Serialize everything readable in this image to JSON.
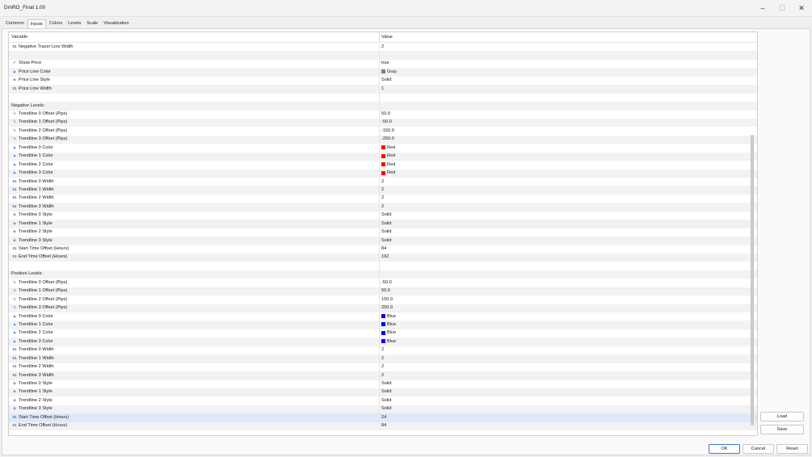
{
  "window": {
    "title": "DmRO_Final 1.00",
    "minimize": "–",
    "maximize": "☐",
    "close": "✕"
  },
  "tabs": [
    "Common",
    "Inputs",
    "Colors",
    "Levels",
    "Scale",
    "Visualization"
  ],
  "active_tab": "Inputs",
  "columns": {
    "variable": "Variable",
    "value": "Value"
  },
  "rows": [
    {
      "icon": "num",
      "name": "Negative Tracer Line Width",
      "value": "2"
    },
    {
      "icon": "",
      "name": "",
      "value": ""
    },
    {
      "icon": "bool",
      "name": "Show Price",
      "value": "true"
    },
    {
      "icon": "color",
      "name": "Price Line Color",
      "value": "Gray",
      "color": "#808080"
    },
    {
      "icon": "style",
      "name": "Price Line Style",
      "value": "Solid"
    },
    {
      "icon": "num",
      "name": "Price Line Width",
      "value": "1"
    },
    {
      "icon": "",
      "name": "",
      "value": ""
    },
    {
      "icon": "",
      "name": "Negative Levels:",
      "value": ""
    },
    {
      "icon": "frac",
      "name": "Trendline 0 Offset (Pips)",
      "value": "50.0"
    },
    {
      "icon": "frac",
      "name": "Trendline 1 Offset (Pips)",
      "value": "-50.0"
    },
    {
      "icon": "frac",
      "name": "Trendline 2 Offset (Pips)",
      "value": "-150.0"
    },
    {
      "icon": "frac",
      "name": "Trendline 3 Offset (Pips)",
      "value": "-250.0"
    },
    {
      "icon": "color",
      "name": "Trendline 0 Color",
      "value": "Red",
      "color": "#ff0000"
    },
    {
      "icon": "color",
      "name": "Trendline 1 Color",
      "value": "Red",
      "color": "#ff0000"
    },
    {
      "icon": "color",
      "name": "Trendline 2 Color",
      "value": "Red",
      "color": "#ff0000"
    },
    {
      "icon": "color",
      "name": "Trendline 3 Color",
      "value": "Red",
      "color": "#ff0000"
    },
    {
      "icon": "num",
      "name": "Trendline 0 Width",
      "value": "2"
    },
    {
      "icon": "num",
      "name": "Trendline 1 Width",
      "value": "2"
    },
    {
      "icon": "num",
      "name": "Trendline 2 Width",
      "value": "2"
    },
    {
      "icon": "num",
      "name": "Trendline 3 Width",
      "value": "2"
    },
    {
      "icon": "style",
      "name": "Trendline 0 Style",
      "value": "Solid"
    },
    {
      "icon": "style",
      "name": "Trendline 1 Style",
      "value": "Solid"
    },
    {
      "icon": "style",
      "name": "Trendline 2 Style",
      "value": "Solid"
    },
    {
      "icon": "style",
      "name": "Trendline 3 Style",
      "value": "Solid"
    },
    {
      "icon": "num",
      "name": "Start Time Offset (Hours)",
      "value": "84"
    },
    {
      "icon": "num",
      "name": "End Time Offset (Hours)",
      "value": "192"
    },
    {
      "icon": "",
      "name": "",
      "value": ""
    },
    {
      "icon": "",
      "name": "Positive Levels:",
      "value": ""
    },
    {
      "icon": "frac",
      "name": "Trendline 0 Offset (Pips)",
      "value": "-50.0"
    },
    {
      "icon": "frac",
      "name": "Trendline 1 Offset (Pips)",
      "value": "50.0"
    },
    {
      "icon": "frac",
      "name": "Trendline 2 Offset (Pips)",
      "value": "150.0"
    },
    {
      "icon": "frac",
      "name": "Trendline 3 Offset (Pips)",
      "value": "250.0"
    },
    {
      "icon": "color",
      "name": "Trendline 0 Color",
      "value": "Blue",
      "color": "#0000ff"
    },
    {
      "icon": "color",
      "name": "Trendline 1 Color",
      "value": "Blue",
      "color": "#0000ff"
    },
    {
      "icon": "color",
      "name": "Trendline 2 Color",
      "value": "Blue",
      "color": "#0000ff"
    },
    {
      "icon": "color",
      "name": "Trendline 3 Color",
      "value": "Blue",
      "color": "#0000ff"
    },
    {
      "icon": "num",
      "name": "Trendline 0 Width",
      "value": "2"
    },
    {
      "icon": "num",
      "name": "Trendline 1 Width",
      "value": "2"
    },
    {
      "icon": "num",
      "name": "Trendline 2 Width",
      "value": "2"
    },
    {
      "icon": "num",
      "name": "Trendline 3 Width",
      "value": "2"
    },
    {
      "icon": "style",
      "name": "Trendline 0 Style",
      "value": "Solid"
    },
    {
      "icon": "style",
      "name": "Trendline 1 Style",
      "value": "Solid"
    },
    {
      "icon": "style",
      "name": "Trendline 2 Style",
      "value": "Solid"
    },
    {
      "icon": "style",
      "name": "Trendline 3 Style",
      "value": "Solid"
    },
    {
      "icon": "num",
      "name": "Start Time Offset (Hours)",
      "value": "24",
      "selected": true
    },
    {
      "icon": "num",
      "name": "End Time Offset (Hours)",
      "value": "84"
    }
  ],
  "side_buttons": {
    "load": "Load",
    "save": "Save"
  },
  "footer": {
    "ok": "OK",
    "cancel": "Cancel",
    "reset": "Reset"
  }
}
